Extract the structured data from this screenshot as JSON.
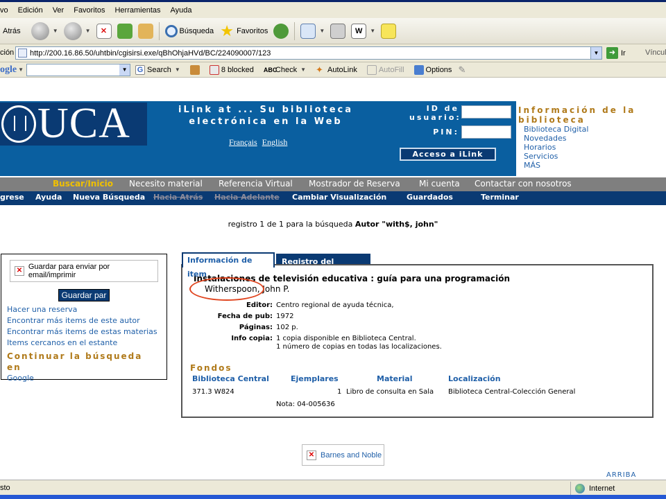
{
  "browser": {
    "menu": [
      "vo",
      "Edición",
      "Ver",
      "Favoritos",
      "Herramientas",
      "Ayuda"
    ],
    "toolbar": {
      "back": "Atrás",
      "search": "Búsqueda",
      "favorites": "Favoritos"
    },
    "address": {
      "label": "ción",
      "url": "http://200.16.86.50/uhtbin/cgisirsi.exe/qBhOhjaHVd/BC/224090007/123",
      "go": "Ir",
      "links": "Víncul"
    },
    "googlebar": {
      "brand": "ogle",
      "search": "Search",
      "blocked": "8 blocked",
      "check": "Check",
      "autolink": "AutoLink",
      "autofill": "AutoFill",
      "options": "Options"
    },
    "status": {
      "text": "sto",
      "zone": "Internet"
    }
  },
  "header": {
    "logo_text": "UCA",
    "ilink_title": "iLink at ... Su biblioteca electrónica en la Web",
    "lang_fr": "Français",
    "lang_en": "English",
    "user_id_label": "ID de usuario:",
    "pin_label": "PIN:",
    "access_button": "Acceso a iLink",
    "info_title": "Información de la biblioteca",
    "info_links": [
      "Biblioteca Digital",
      "Novedades",
      "Horarios",
      "Servicios",
      "MÁS"
    ]
  },
  "nav_primary": [
    "Buscar/Inicio",
    "Necesito material",
    "Referencia Virtual",
    "Mostrador de Reserva",
    "Mi cuenta",
    "Contactar con nosotros"
  ],
  "nav_secondary": [
    "gresе",
    "Ayuda",
    "Nueva Búsqueda",
    "Hacia Atrás",
    "Hacia Adelante",
    "Cambiar Visualización",
    "Guardados",
    "Terminar"
  ],
  "results": {
    "prefix": "registro 1 de 1 para la búsqueda",
    "query": "Autor \"with$, john\""
  },
  "sidebar": {
    "save_image_alt": "Guardar para enviar por email/imprimir",
    "save_button": "Guardar par",
    "links": [
      "Hacer una reserva",
      "Encontrar más items de este autor",
      "Encontrar más items de estas materias",
      "Items cercanos en el estante"
    ],
    "continue_heading": "Continuar la búsqueda en",
    "continue_link": "Google"
  },
  "tabs": {
    "item_info": "Información de item",
    "catalog": "Registro del catálogo"
  },
  "record": {
    "title": "Instalaciones de televisión educativa : guía para una programación",
    "author": "Witherspoon, John P.",
    "fields": [
      {
        "label": "Editor:",
        "value": "Centro regional de ayuda técnica,"
      },
      {
        "label": "Fecha de pub:",
        "value": "1972"
      },
      {
        "label": "Páginas:",
        "value": "102 p."
      },
      {
        "label": "Info copia:",
        "value": "1 copia disponible en Biblioteca Central.",
        "value2": "1 número de copias en todas las localizaciones."
      }
    ],
    "holdings_heading": "Fondos",
    "holdings_headers": [
      "Biblioteca Central",
      "Ejemplares",
      "Material",
      "Localización"
    ],
    "holdings_row": {
      "call_number": "371.3 W824",
      "copies": "1",
      "material": "Libro de consulta en Sala",
      "location": "Biblioteca Central-Colección General"
    },
    "note": "Nota: 04-005636"
  },
  "footer": {
    "barnes": "Barnes and Noble",
    "top": "ARRIBA"
  },
  "colors": {
    "header_blue": "#0a5fa0",
    "navy": "#0a3a73",
    "gold": "#b07a1a",
    "link": "#1f5fa8",
    "highlight_oval": "#e0451f"
  }
}
